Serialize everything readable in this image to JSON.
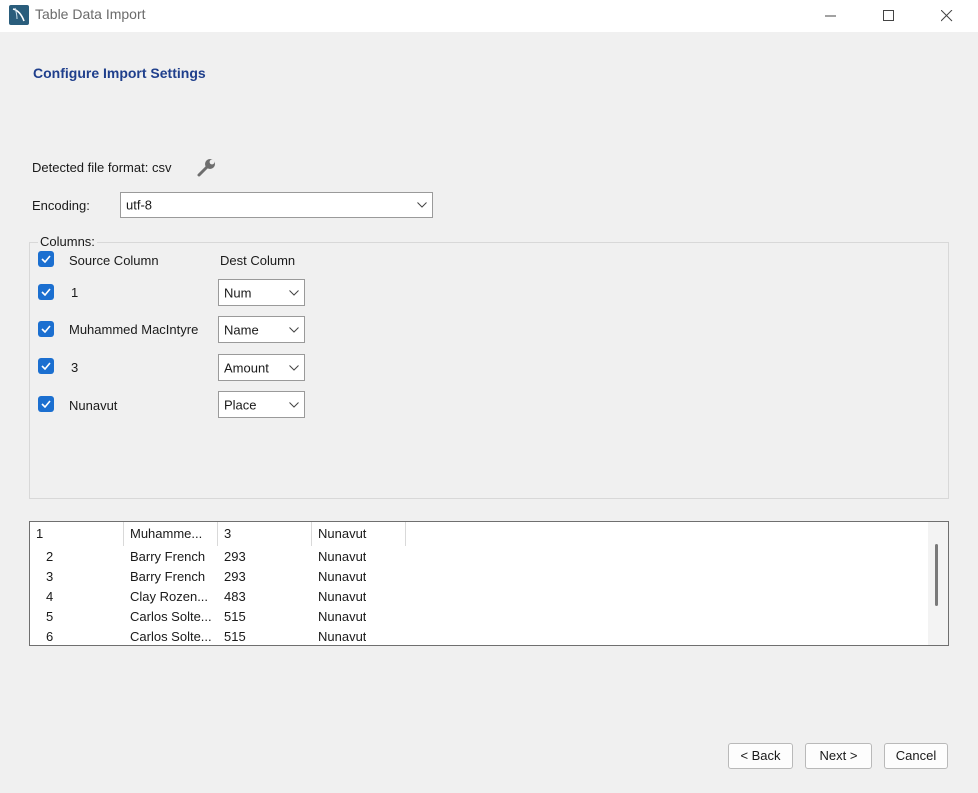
{
  "window": {
    "title": "Table Data Import"
  },
  "page": {
    "heading": "Configure Import Settings"
  },
  "format": {
    "label": "Detected file format: csv"
  },
  "encoding": {
    "label": "Encoding:",
    "value": "utf-8"
  },
  "columns": {
    "group_label": "Columns:",
    "source_header": "Source Column",
    "dest_header": "Dest Column",
    "rows": [
      {
        "source": "1",
        "dest": "Num",
        "checked": true
      },
      {
        "source": "Muhammed MacIntyre",
        "dest": "Name",
        "checked": true
      },
      {
        "source": "3",
        "dest": "Amount",
        "checked": true
      },
      {
        "source": "Nunavut",
        "dest": "Place",
        "checked": true
      }
    ]
  },
  "preview": {
    "headers": [
      "1",
      "Muhamme...",
      "3",
      "Nunavut"
    ],
    "rows": [
      [
        "2",
        "Barry French",
        "293",
        "Nunavut"
      ],
      [
        "3",
        "Barry French",
        "293",
        "Nunavut"
      ],
      [
        "4",
        "Clay Rozen...",
        "483",
        "Nunavut"
      ],
      [
        "5",
        "Carlos Solte...",
        "515",
        "Nunavut"
      ],
      [
        "6",
        "Carlos Solte...",
        "515",
        "Nunavut"
      ]
    ]
  },
  "buttons": {
    "back": "< Back",
    "next": "Next >",
    "cancel": "Cancel"
  },
  "colors": {
    "accent": "#1b6fd0",
    "heading": "#1f3f8c"
  }
}
